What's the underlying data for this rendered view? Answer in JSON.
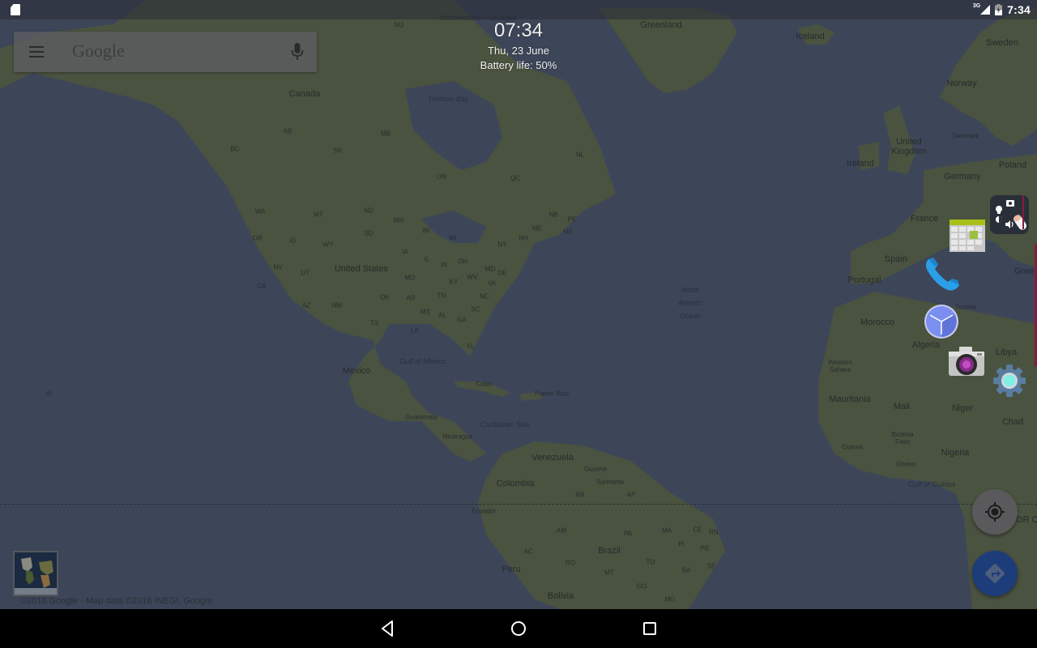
{
  "status_bar": {
    "left_icons": [
      "sd-card-icon"
    ],
    "network_type": "3G",
    "time": "7:34",
    "icons": [
      "signal-icon",
      "battery-charging-icon"
    ]
  },
  "search_bar": {
    "menu_icon": "hamburger-menu-icon",
    "logo_text": "Google",
    "mic_icon": "microphone-icon"
  },
  "overlay_clock": {
    "time": "07:34",
    "date": "Thu, 23 June",
    "battery": "Battery life: 50%"
  },
  "floating_apps": [
    {
      "name": "quick-settings-panel",
      "icon": "quick-settings-icon"
    },
    {
      "name": "calendar-app",
      "icon": "calendar-icon"
    },
    {
      "name": "phone-app",
      "icon": "phone-icon"
    },
    {
      "name": "clock-app",
      "icon": "clock-icon"
    },
    {
      "name": "camera-app",
      "icon": "camera-icon"
    },
    {
      "name": "settings-app",
      "icon": "gear-icon"
    }
  ],
  "map": {
    "attribution": "©2016 Google - Map data ©2016 INEGI, Google",
    "layers_thumbnail": "satellite-layer-thumbnail",
    "labels": {
      "countries": [
        "Canada",
        "United States",
        "Mexico",
        "Greenland",
        "Iceland",
        "Sweden",
        "Norway",
        "United Kingdom",
        "Ireland",
        "Denmark",
        "Germany",
        "Poland",
        "France",
        "Spain",
        "Portugal",
        "Morocco",
        "Algeria",
        "Libya",
        "Western Sahara",
        "Mauritania",
        "Mali",
        "Niger",
        "Chad",
        "Burkina Faso",
        "Nigeria",
        "Guinea",
        "Ghana",
        "Cuba",
        "Puerto Rico",
        "Guatemala",
        "Nicaragua",
        "Venezuela",
        "Guyana",
        "Suriname",
        "Colombia",
        "Ecuador",
        "Peru",
        "Brazil",
        "Bolivia",
        "Tunisia",
        "Greece",
        "DR C"
      ],
      "water": [
        "Hudson Bay",
        "Northwestern Passages",
        "Gulf of Mexico",
        "Caribbean Sea",
        "North Atlantic Ocean",
        "Gulf of Guinea"
      ],
      "regions": [
        "NU",
        "AB",
        "BC",
        "SK",
        "MB",
        "ON",
        "QC",
        "NL",
        "NB",
        "PE",
        "NS",
        "WA",
        "MT",
        "ND",
        "MN",
        "WI",
        "MI",
        "OR",
        "ID",
        "WY",
        "SD",
        "IA",
        "NY",
        "NH",
        "ME",
        "NV",
        "UT",
        "IL",
        "IN",
        "OH",
        "MD",
        "DE",
        "CA",
        "MO",
        "KY",
        "WV",
        "VA",
        "OK",
        "AR",
        "TN",
        "NC",
        "AZ",
        "NM",
        "SC",
        "MS",
        "AL",
        "GA",
        "TX",
        "LA",
        "FL",
        "HI",
        "RR",
        "AP",
        "AM",
        "PA",
        "MA",
        "CE",
        "RN",
        "PI",
        "PE",
        "AC",
        "RO",
        "TO",
        "SE",
        "BA",
        "MT",
        "GO",
        "MG"
      ]
    }
  },
  "map_controls": {
    "my_location": "my-location-icon",
    "directions": "directions-icon"
  },
  "nav_bar": {
    "back": "back-icon",
    "home": "home-icon",
    "recents": "recents-icon"
  }
}
